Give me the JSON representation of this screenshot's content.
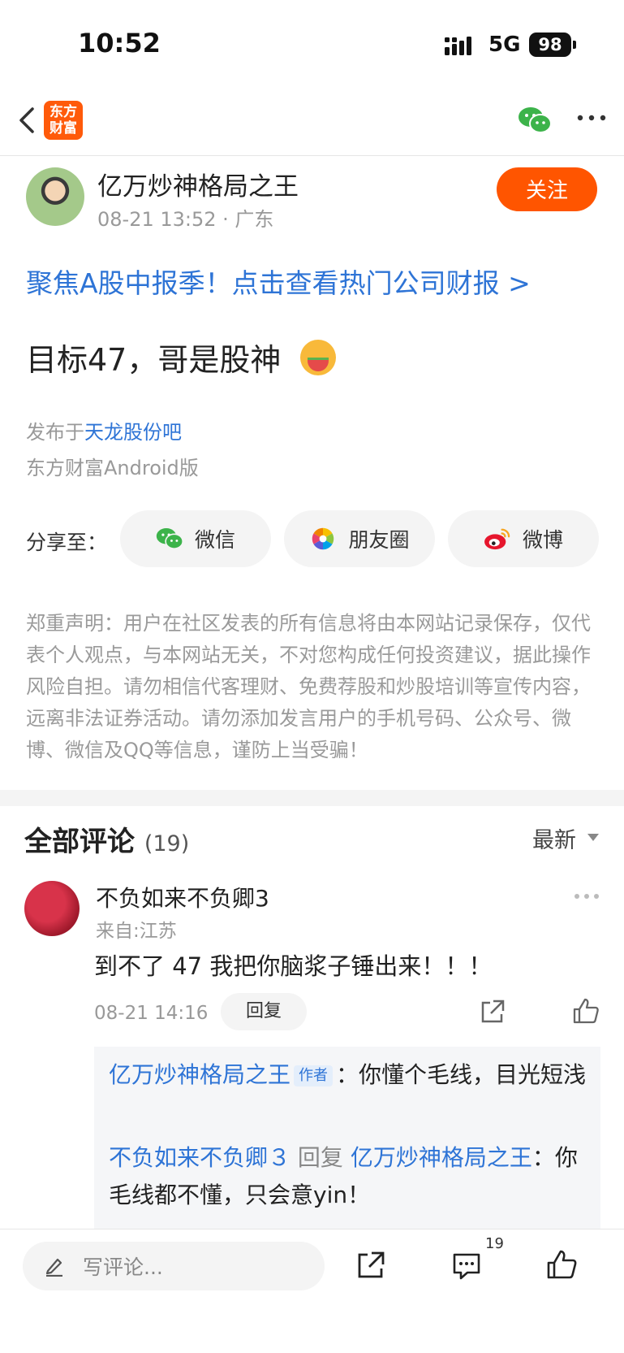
{
  "status_bar": {
    "time": "10:52",
    "network": "5G",
    "battery": "98"
  },
  "nav": {
    "logo_text": "东方\n财富",
    "logo_line1": "东方",
    "logo_line2": "财富"
  },
  "author": {
    "name": "亿万炒神格局之王",
    "meta": "08-21 13:52 · 广东",
    "follow_label": "关注"
  },
  "promo": "聚焦A股中报季！点击查看热门公司财报 >",
  "post": {
    "title": "目标47，哥是股神"
  },
  "publish": {
    "prefix": "发布于",
    "forum": "天龙股份吧",
    "client": "东方财富Android版"
  },
  "share": {
    "label": "分享至：",
    "targets": [
      {
        "label": "微信",
        "icon": "wechat-icon",
        "color": "#3cb34a"
      },
      {
        "label": "朋友圈",
        "icon": "moments-icon",
        "color": "#f2a100"
      },
      {
        "label": "微博",
        "icon": "weibo-icon",
        "color": "#e6162d"
      }
    ]
  },
  "disclaimer": "郑重声明：用户在社区发表的所有信息将由本网站记录保存，仅代表个人观点，与本网站无关，不对您构成任何投资建议，据此操作风险自担。请勿相信代客理财、免费荐股和炒股培训等宣传内容，远离非法证券活动。请勿添加发言用户的手机号码、公众号、微博、微信及QQ等信息，谨防上当受骗！",
  "comments": {
    "title": "全部评论",
    "count": "(19)",
    "sort_label": "最新",
    "items": [
      {
        "user": "不负如来不负卿3",
        "location": "来自:江苏",
        "text": "到不了 47 我把你脑浆子锤出来！！！",
        "time": "08-21 14:16",
        "reply_label": "回复",
        "replies": [
          {
            "from": "亿万炒神格局之王",
            "tag": "作者",
            "sep": "：",
            "text": "你懂个毛线，目光短浅"
          },
          {
            "from": "不负如来不负卿３",
            "verb": "回复",
            "to": "亿万炒神格局之王",
            "sep": "：",
            "text": "你毛线都不懂，只会意yin！"
          }
        ]
      }
    ]
  },
  "bottom_bar": {
    "input_placeholder": "写评论...",
    "comment_count": "19"
  },
  "colors": {
    "accent": "#ff5500",
    "link": "#2e74d6",
    "muted": "#999999"
  }
}
